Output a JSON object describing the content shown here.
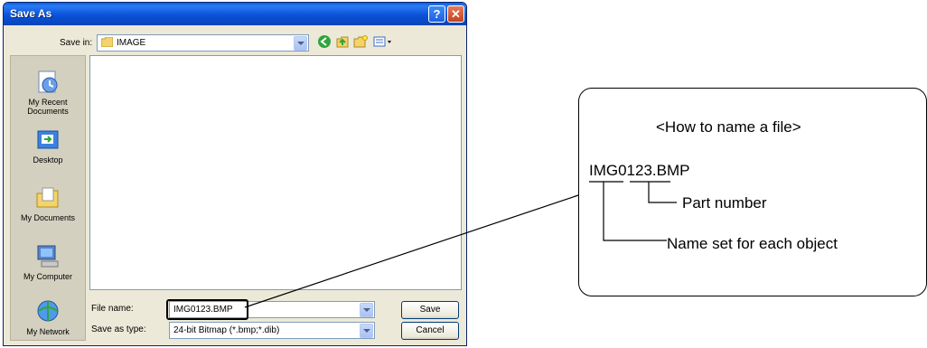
{
  "dialog": {
    "title": "Save As",
    "help_symbol": "?",
    "close_symbol": "✕",
    "save_in_label": "Save in:",
    "save_in_value": "IMAGE",
    "places": [
      "My Recent Documents",
      "Desktop",
      "My Documents",
      "My Computer",
      "My Network"
    ],
    "file_name_label": "File name:",
    "file_name_value": "IMG0123.BMP",
    "save_as_type_label": "Save as type:",
    "save_as_type_value": "24-bit Bitmap (*.bmp;*.dib)",
    "save_button": "Save",
    "cancel_button": "Cancel"
  },
  "callout": {
    "title": "<How to name a file>",
    "filename": "IMG0123.BMP",
    "part_number_label": "Part number",
    "name_label": "Name set for each object"
  },
  "icons": {
    "folder": "folder-icon",
    "back": "back-icon",
    "up": "up-folder-icon",
    "new_folder": "new-folder-icon",
    "views": "views-menu-icon"
  }
}
